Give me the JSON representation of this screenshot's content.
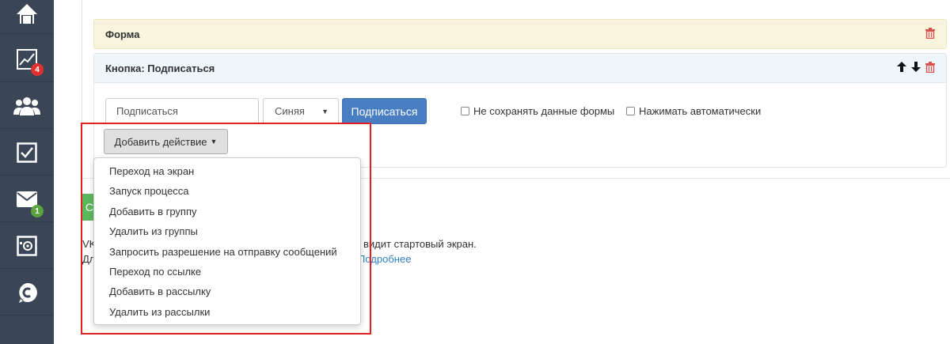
{
  "sidebar": {
    "items": [
      {
        "icon": "home-icon"
      },
      {
        "icon": "chart-icon",
        "badge": "4",
        "badge_color": "#e0312f"
      },
      {
        "icon": "users-icon"
      },
      {
        "icon": "checkbox-icon"
      },
      {
        "icon": "mail-icon",
        "badge": "1",
        "badge_color": "#5aa33e"
      },
      {
        "icon": "safe-icon"
      },
      {
        "icon": "chat-logo-icon"
      }
    ]
  },
  "form_panel": {
    "title": "Форма",
    "delete_icon": "trash-icon"
  },
  "button_panel": {
    "title": "Кнопка: Подписаться",
    "up_icon": "arrow-up-icon",
    "down_icon": "arrow-down-icon",
    "delete_icon": "trash-icon"
  },
  "button_editor": {
    "label_value": "Подписаться",
    "color_select": "Синяя",
    "preview_label": "Подписаться",
    "checkbox_no_save": "Не сохранять данные формы",
    "checkbox_auto_press": "Нажимать автоматически"
  },
  "add_action": {
    "label": "Добавить действие",
    "menu": [
      "Переход на экран",
      "Запуск процесса",
      "Добавить в группу",
      "Удалить из группы",
      "Запросить разрешение на отправку сообщений",
      "Переход по ссылке",
      "Добавить в рассылку",
      "Удалить из рассылки"
    ]
  },
  "background_text": {
    "green_button": "С",
    "line1_left": "VK",
    "line1_right": "видит стартовый экран.",
    "line2_left": "Дл",
    "line2_link": "Подробнее"
  },
  "colors": {
    "sidebar": "#3a4656",
    "primary": "#4a7ec2",
    "form_header": "#fcf8e3",
    "button_header": "#eef5fb",
    "highlight": "#e41e1e"
  }
}
